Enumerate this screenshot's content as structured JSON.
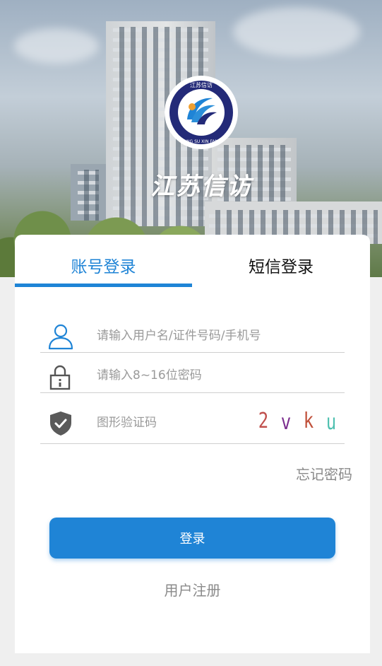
{
  "header": {
    "brand_title": "江苏信访",
    "logo_text_top": "江苏信访",
    "logo_text_bottom": "JIANG SU XIN FANG"
  },
  "tabs": [
    {
      "label": "账号登录",
      "active": true
    },
    {
      "label": "短信登录",
      "active": false
    }
  ],
  "form": {
    "username_placeholder": "请输入用户名/证件号码/手机号",
    "password_placeholder": "请输入8~16位密码",
    "captcha_placeholder": "图形验证码",
    "captcha_chars": [
      "2",
      "v",
      "k",
      "u"
    ],
    "forgot_label": "忘记密码",
    "login_label": "登录",
    "register_label": "用户注册"
  },
  "colors": {
    "accent": "#1f84d6",
    "captcha_colors": [
      "#c0504d",
      "#7b2d8e",
      "#c0503a",
      "#4fc0b0"
    ]
  },
  "icons": [
    "user-icon",
    "lock-icon",
    "shield-check-icon"
  ]
}
